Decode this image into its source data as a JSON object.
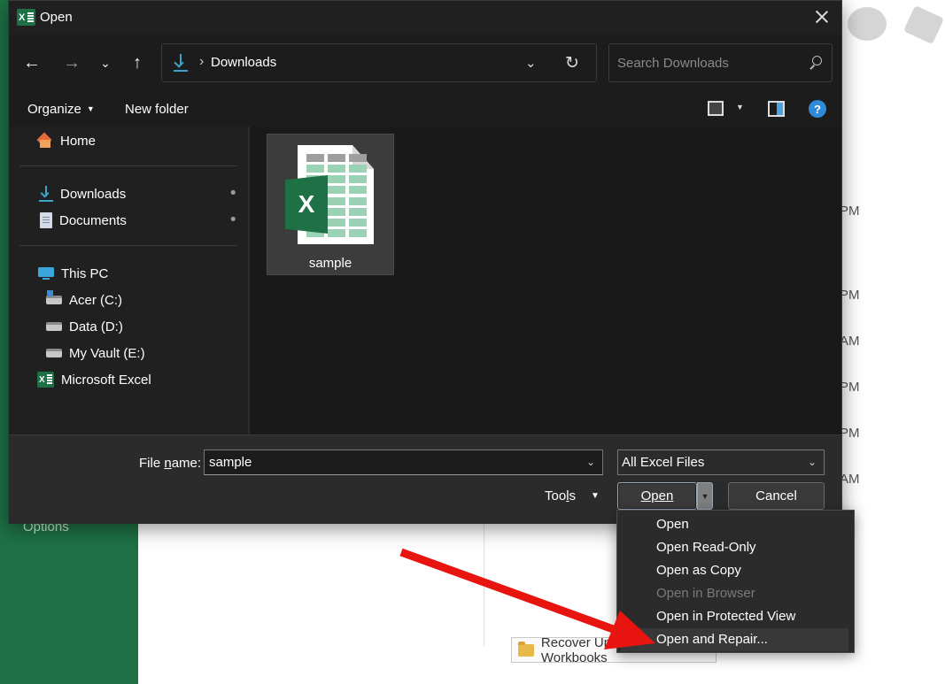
{
  "background": {
    "options_label": "Options",
    "times": [
      "PM",
      "PM",
      "AM",
      "PM",
      "PM",
      "AM"
    ],
    "recover_button": "Recover Unsaved Workbooks"
  },
  "dialog": {
    "title": "Open",
    "address": {
      "location": "Downloads"
    },
    "search": {
      "placeholder": "Search Downloads"
    },
    "commands": {
      "organize": "Organize",
      "new_folder": "New folder"
    },
    "nav": {
      "home": "Home",
      "downloads": "Downloads",
      "documents": "Documents",
      "this_pc": "This PC",
      "acer": "Acer (C:)",
      "data": "Data (D:)",
      "vault": "My Vault (E:)",
      "excel": "Microsoft Excel"
    },
    "files": [
      {
        "name": "sample",
        "type": "excel"
      }
    ],
    "file_name_label": "File name:",
    "file_name_value": "sample",
    "file_type": "All Excel Files",
    "tools": "Tools",
    "open": "Open",
    "cancel": "Cancel"
  },
  "open_menu": {
    "items": [
      {
        "label": "Open",
        "enabled": true
      },
      {
        "label": "Open Read-Only",
        "enabled": true
      },
      {
        "label": "Open as Copy",
        "enabled": true
      },
      {
        "label": "Open in Browser",
        "enabled": false
      },
      {
        "label": "Open in Protected View",
        "enabled": true
      },
      {
        "label": "Open and Repair...",
        "enabled": true,
        "highlighted": true
      }
    ]
  },
  "colors": {
    "excel_green": "#1e7145",
    "dialog_bg": "#202020",
    "annotation_red": "#e8140f",
    "accent_blue": "#3aa6c9"
  }
}
